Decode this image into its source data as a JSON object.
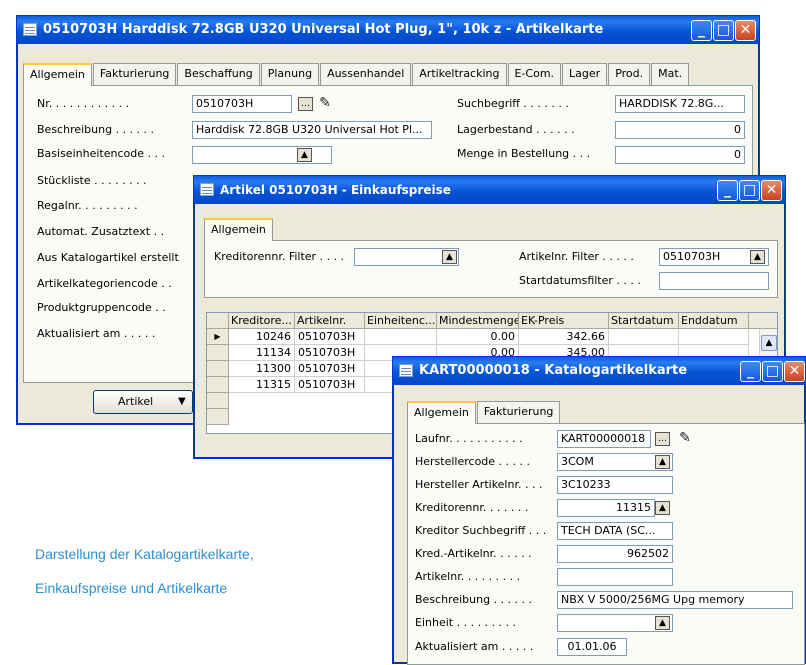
{
  "artikel": {
    "title": "0510703H Harddisk 72.8GB U320 Universal Hot Plug, 1\", 10k z - Artikelkarte",
    "tabs": [
      "Allgemein",
      "Fakturierung",
      "Beschaffung",
      "Planung",
      "Aussenhandel",
      "Artikeltracking",
      "E-Com.",
      "Lager",
      "Prod.",
      "Mat."
    ],
    "labels": [
      "Nr. . . . . . . . . . . .",
      "Beschreibung . . . . . .",
      "Basiseinheitencode . . .",
      "Stückliste . . . . . . . .",
      "Regalnr. . . . . . . . .",
      "Automat. Zusatztext . .",
      "Aus Katalogartikel erstellt",
      "Artikelkategoriencode . .",
      "Produktgruppencode . .",
      "Aktualisiert am . . . . ."
    ],
    "nr_value": "0510703H",
    "beschreibung_value": "Harddisk 72.8GB U320 Universal Hot Pl...",
    "basis_value": "",
    "right_labels": [
      "Suchbegriff . . . . . . .",
      "Lagerbestand . . . . . .",
      "Menge in Bestellung . . ."
    ],
    "suchbegriff_value": "HARDDISK 72.8G...",
    "lagerbestand_value": "0",
    "menge_value": "0",
    "artikel_button": "Artikel",
    "artikel_button_accel": "k"
  },
  "einkauf": {
    "title": "Artikel 0510703H - Einkaufspreise",
    "tab": "Allgemein",
    "kreditor_filter_label": "Kreditorennr. Filter . . . .",
    "kreditor_filter_value": "",
    "artikel_filter_label": "Artikelnr. Filter . . . . .",
    "artikel_filter_value": "0510703H",
    "startdatum_filter_label": "Startdatumsfilter . . . .",
    "startdatum_filter_value": "",
    "columns": [
      "Kreditore...",
      "Artikelnr.",
      "Einheitenc...",
      "Mindestmenge",
      "EK-Preis",
      "Startdatum",
      "Enddatum"
    ],
    "rows": [
      [
        "10246",
        "0510703H",
        "",
        "0.00",
        "342.66",
        "",
        ""
      ],
      [
        "11134",
        "0510703H",
        "",
        "0.00",
        "345.00",
        "",
        ""
      ],
      [
        "11300",
        "0510703H",
        "",
        "",
        "",
        "",
        ""
      ],
      [
        "11315",
        "0510703H",
        "",
        "",
        "",
        "",
        ""
      ]
    ]
  },
  "katalog": {
    "title": "KART00000018 - Katalogartikelkarte",
    "tabs": [
      "Allgemein",
      "Fakturierung"
    ],
    "fields": [
      {
        "label": "Laufnr. . . . . . . . . . .",
        "value": "KART00000018"
      },
      {
        "label": "Herstellercode . . . . .",
        "value": "3COM"
      },
      {
        "label": "Hersteller Artikelnr. . . .",
        "value": "3C10233"
      },
      {
        "label": "Kreditorennr. . . . . . .",
        "value": "11315"
      },
      {
        "label": "Kreditor Suchbegriff . . .",
        "value": "TECH DATA (SC..."
      },
      {
        "label": "Kred.-Artikelnr. . . . . .",
        "value": "962502"
      },
      {
        "label": "Artikelnr. . . . . . . . .",
        "value": ""
      },
      {
        "label": "Beschreibung . . . . . .",
        "value": "NBX V 5000/256MG Upg memory"
      },
      {
        "label": "Einheit . . . . . . . . .",
        "value": ""
      },
      {
        "label": "Aktualisiert am . . . . .",
        "value": "01.01.06"
      }
    ]
  },
  "caption": {
    "line1": "Darstellung der Katalogartikelkarte,",
    "line2": "Einkaufspreise und Artikelkarte"
  }
}
